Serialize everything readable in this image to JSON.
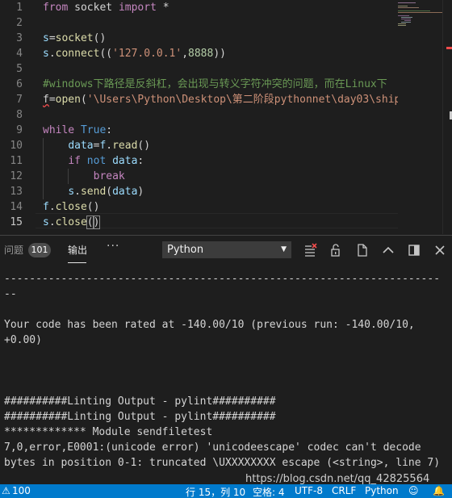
{
  "editor": {
    "line_numbers": [
      "1",
      "2",
      "3",
      "4",
      "5",
      "6",
      "7",
      "8",
      "9",
      "10",
      "11",
      "12",
      "13",
      "14",
      "15"
    ],
    "active_line": "15",
    "lines": [
      [
        {
          "t": "from",
          "c": "kw"
        },
        {
          "t": " socket ",
          "c": "plain"
        },
        {
          "t": "import",
          "c": "kw"
        },
        {
          "t": " *",
          "c": "plain"
        }
      ],
      [],
      [
        {
          "t": "s",
          "c": "var"
        },
        {
          "t": "=",
          "c": "plain"
        },
        {
          "t": "socket",
          "c": "fn"
        },
        {
          "t": "()",
          "c": "plain"
        }
      ],
      [
        {
          "t": "s",
          "c": "var"
        },
        {
          "t": ".",
          "c": "plain"
        },
        {
          "t": "connect",
          "c": "fn"
        },
        {
          "t": "((",
          "c": "plain"
        },
        {
          "t": "'127.0.0.1'",
          "c": "str"
        },
        {
          "t": ",",
          "c": "plain"
        },
        {
          "t": "8888",
          "c": "num"
        },
        {
          "t": "))",
          "c": "plain"
        }
      ],
      [],
      [
        {
          "t": "#windows下路径是反斜杠，会出现与转义字符冲突的问题，而在Linux下",
          "c": "cm"
        }
      ],
      [
        {
          "t": "f",
          "c": "squig"
        },
        {
          "t": "=",
          "c": "plain"
        },
        {
          "t": "open",
          "c": "fn"
        },
        {
          "t": "(",
          "c": "plain"
        },
        {
          "t": "'\\Users\\Python\\Desktop\\第二阶段pythonnet\\day03\\ship",
          "c": "str"
        }
      ],
      [],
      [
        {
          "t": "while",
          "c": "kw"
        },
        {
          "t": " ",
          "c": "plain"
        },
        {
          "t": "True",
          "c": "kw2"
        },
        {
          "t": ":",
          "c": "plain"
        }
      ],
      [
        {
          "t": "    ",
          "c": "plain"
        },
        {
          "t": "data",
          "c": "var"
        },
        {
          "t": "=",
          "c": "plain"
        },
        {
          "t": "f",
          "c": "var"
        },
        {
          "t": ".",
          "c": "plain"
        },
        {
          "t": "read",
          "c": "fn"
        },
        {
          "t": "()",
          "c": "plain"
        }
      ],
      [
        {
          "t": "    ",
          "c": "plain"
        },
        {
          "t": "if",
          "c": "kw"
        },
        {
          "t": " ",
          "c": "plain"
        },
        {
          "t": "not",
          "c": "kw2"
        },
        {
          "t": " ",
          "c": "plain"
        },
        {
          "t": "data",
          "c": "var"
        },
        {
          "t": ":",
          "c": "plain"
        }
      ],
      [
        {
          "t": "        ",
          "c": "plain"
        },
        {
          "t": "break",
          "c": "kw"
        }
      ],
      [
        {
          "t": "    ",
          "c": "plain"
        },
        {
          "t": "s",
          "c": "var"
        },
        {
          "t": ".",
          "c": "plain"
        },
        {
          "t": "send",
          "c": "fn"
        },
        {
          "t": "(",
          "c": "plain"
        },
        {
          "t": "data",
          "c": "var"
        },
        {
          "t": ")",
          "c": "plain"
        }
      ],
      [
        {
          "t": "f",
          "c": "var"
        },
        {
          "t": ".",
          "c": "plain"
        },
        {
          "t": "close",
          "c": "fn"
        },
        {
          "t": "()",
          "c": "plain"
        }
      ],
      [
        {
          "t": "s",
          "c": "var"
        },
        {
          "t": ".",
          "c": "plain"
        },
        {
          "t": "close",
          "c": "fn"
        },
        {
          "t": "(",
          "c": "bm"
        },
        {
          "t": ")",
          "c": "bm"
        }
      ]
    ]
  },
  "panel": {
    "tab_problems": "问题",
    "problems_count": "101",
    "tab_output": "输出",
    "more_label": "···",
    "channel_value": "Python",
    "icons": [
      "clear-output-icon",
      "lock-scroll-icon",
      "open-log-icon",
      "maximize-panel-icon",
      "split-layout-icon",
      "close-panel-icon"
    ]
  },
  "output": {
    "lines": [
      "---------------------------------------------------------------------",
      "--",
      "",
      "Your code has been rated at -140.00/10 (previous run: -140.00/10,",
      "+0.00)",
      "",
      "",
      "",
      "##########Linting Output - pylint##########",
      "##########Linting Output - pylint##########",
      "************* Module sendfiletest",
      "7,0,error,E0001:(unicode error) 'unicodeescape' codec can't decode",
      "bytes in position 0-1: truncated \\UXXXXXXXX escape (<string>, line 7)"
    ]
  },
  "status": {
    "problems": "100",
    "position": "行 15，列 10",
    "indent": "空格: 4",
    "encoding": "UTF-8",
    "eol": "CRLF",
    "language": "Python"
  },
  "watermark": "https://blog.csdn.net/qq_42825564",
  "colors": {
    "statusbar": "#007acc",
    "background": "#1e1e1e",
    "keyword": "#c586c0",
    "string": "#ce9178",
    "comment": "#6a9955",
    "function": "#dcdcaa"
  }
}
